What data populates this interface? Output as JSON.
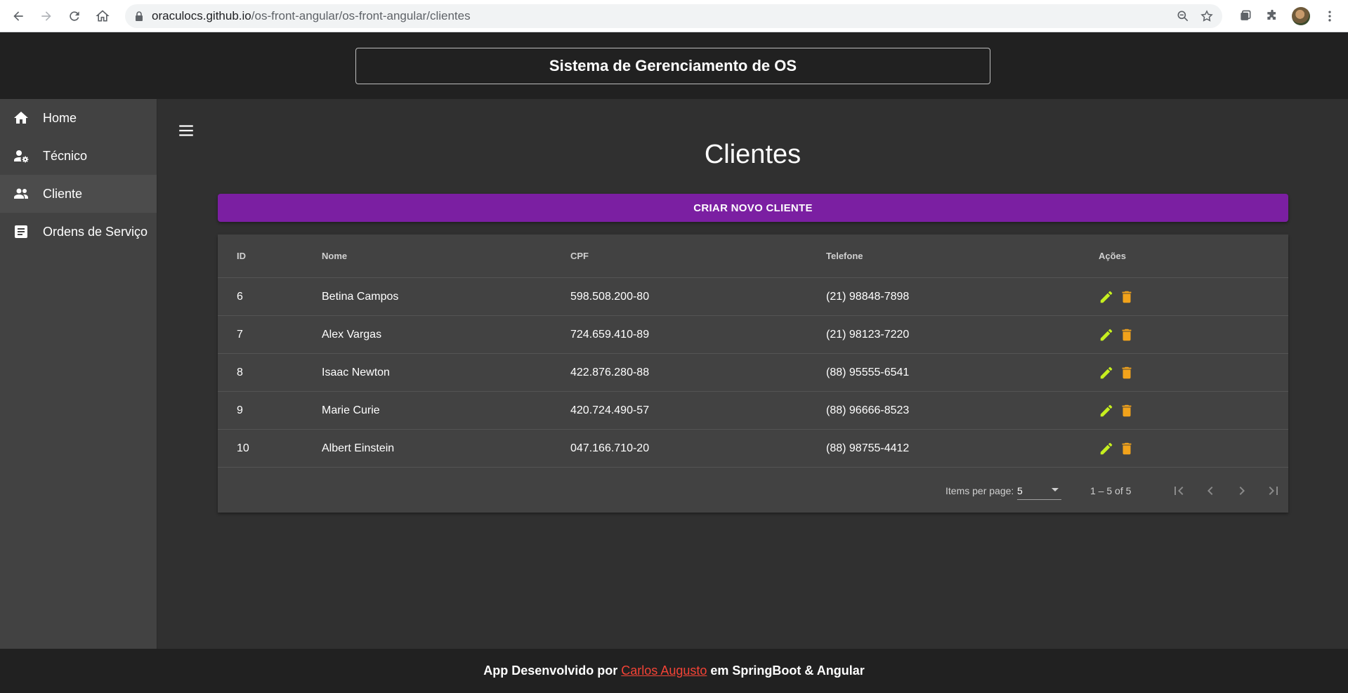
{
  "browser": {
    "url_host": "oraculocs.github.io",
    "url_path": "/os-front-angular/os-front-angular/clientes"
  },
  "header": {
    "title": "Sistema de Gerenciamento de OS"
  },
  "sidebar": {
    "items": [
      {
        "label": "Home",
        "icon": "home-icon"
      },
      {
        "label": "Técnico",
        "icon": "person-gear-icon"
      },
      {
        "label": "Cliente",
        "icon": "people-icon",
        "active": true
      },
      {
        "label": "Ordens de Serviço",
        "icon": "document-icon"
      }
    ]
  },
  "main": {
    "title": "Clientes",
    "create_button": "CRIAR NOVO CLIENTE"
  },
  "table": {
    "columns": [
      "ID",
      "Nome",
      "CPF",
      "Telefone",
      "Ações"
    ],
    "rows": [
      {
        "id": "6",
        "nome": "Betina Campos",
        "cpf": "598.508.200-80",
        "telefone": "(21) 98848-7898"
      },
      {
        "id": "7",
        "nome": "Alex Vargas",
        "cpf": "724.659.410-89",
        "telefone": "(21) 98123-7220"
      },
      {
        "id": "8",
        "nome": "Isaac Newton",
        "cpf": "422.876.280-88",
        "telefone": "(88) 95555-6541"
      },
      {
        "id": "9",
        "nome": "Marie Curie",
        "cpf": "420.724.490-57",
        "telefone": "(88) 96666-8523"
      },
      {
        "id": "10",
        "nome": "Albert Einstein",
        "cpf": "047.166.710-20",
        "telefone": "(88) 98755-4412"
      }
    ],
    "action_colors": {
      "edit": "#c6ef1f",
      "delete": "#f2a31b"
    }
  },
  "paginator": {
    "items_per_page_label": "Items per page:",
    "items_per_page_value": "5",
    "range": "1 – 5 of 5"
  },
  "footer": {
    "prefix": "App Desenvolvido por",
    "author": "Carlos Augusto",
    "suffix": "em SpringBoot & Angular"
  },
  "colors": {
    "accent": "#7b1fa2",
    "link": "#f44336"
  }
}
